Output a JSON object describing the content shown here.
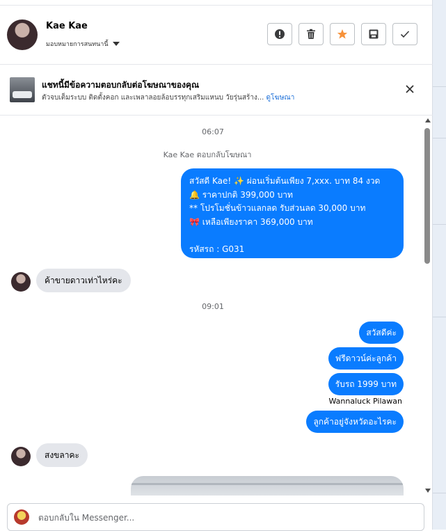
{
  "header": {
    "name": "Kae Kae",
    "assign_label": "มอบหมายการสนทนานี้"
  },
  "ad_bar": {
    "title": "แชทนี้มีข้อความตอบกลับต่อโฆษณาของคุณ",
    "subtitle": "ตัวจบเต็มระบบ ติดตั้งคอก และเพลาลอยล้อบรรทุกเสริมแหนบ วัยรุ่นสร้าง... ",
    "link": "ดูโฆษณา"
  },
  "messages": {
    "time1": "06:07",
    "system_note": "Kae Kae ตอบกลับโฆษณา",
    "ad_reply_lines": [
      "สวัสดี Kae! ✨  ผ่อนเริ่มต้นเพียง 7,xxx. บาท 84 งวด",
      "🔔 ราคาปกติ 399,000 บาท",
      "** โปรโมชั่นข้าวแลกลด รับส่วนลด 30,000 บาท",
      "🎀  เหลือเพียงราคา 369,000 บาท",
      "",
      "รหัสรถ : G031"
    ],
    "in1": "ค้าขายดาวเท่าไหร่คะ",
    "time2": "09:01",
    "out1": "สวัสดีค่ะ",
    "out2": "ฟรีดาวน์ค่ะลูกค้า",
    "out3": "รับรถ 1999 บาท",
    "sender": "Wannaluck Pilawan",
    "out4": "ลูกค้าอยู่จังหวัดอะไรคะ",
    "in2": "สงขลาคะ"
  },
  "composer": {
    "placeholder": "ตอบกลับใน Messenger..."
  },
  "colors": {
    "outgoing": "#0a7cff",
    "incoming": "#e4e6eb",
    "star": "#f7923a",
    "link": "#1a6ed8"
  }
}
